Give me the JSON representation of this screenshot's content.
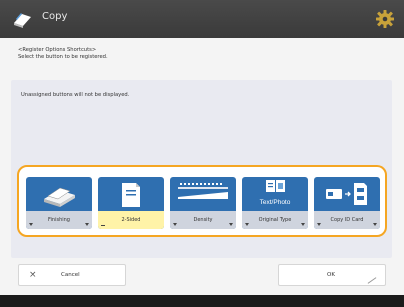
{
  "window": {
    "title": "Copy"
  },
  "instructions": {
    "line1": "<Register Options Shortcuts>",
    "line2": "Select the button to be registered."
  },
  "panel": {
    "note": "Unassigned buttons will not be displayed."
  },
  "shortcuts": [
    {
      "label": "Finishing",
      "icon": "finishing-icon"
    },
    {
      "label": "2-Sided",
      "icon": "two-sided-icon",
      "selected": true
    },
    {
      "label": "Density",
      "icon": "density-icon"
    },
    {
      "label": "Original Type",
      "icon": "text-photo-icon",
      "icon_text": "Text/Photo"
    },
    {
      "label": "Copy ID Card",
      "icon": "id-card-icon"
    }
  ],
  "footer": {
    "cancel_label": "Cancel",
    "ok_label": "OK"
  },
  "colors": {
    "accent": "#f5a623",
    "button_blue": "#2f6fb0",
    "selected_label": "#fff3a8"
  }
}
